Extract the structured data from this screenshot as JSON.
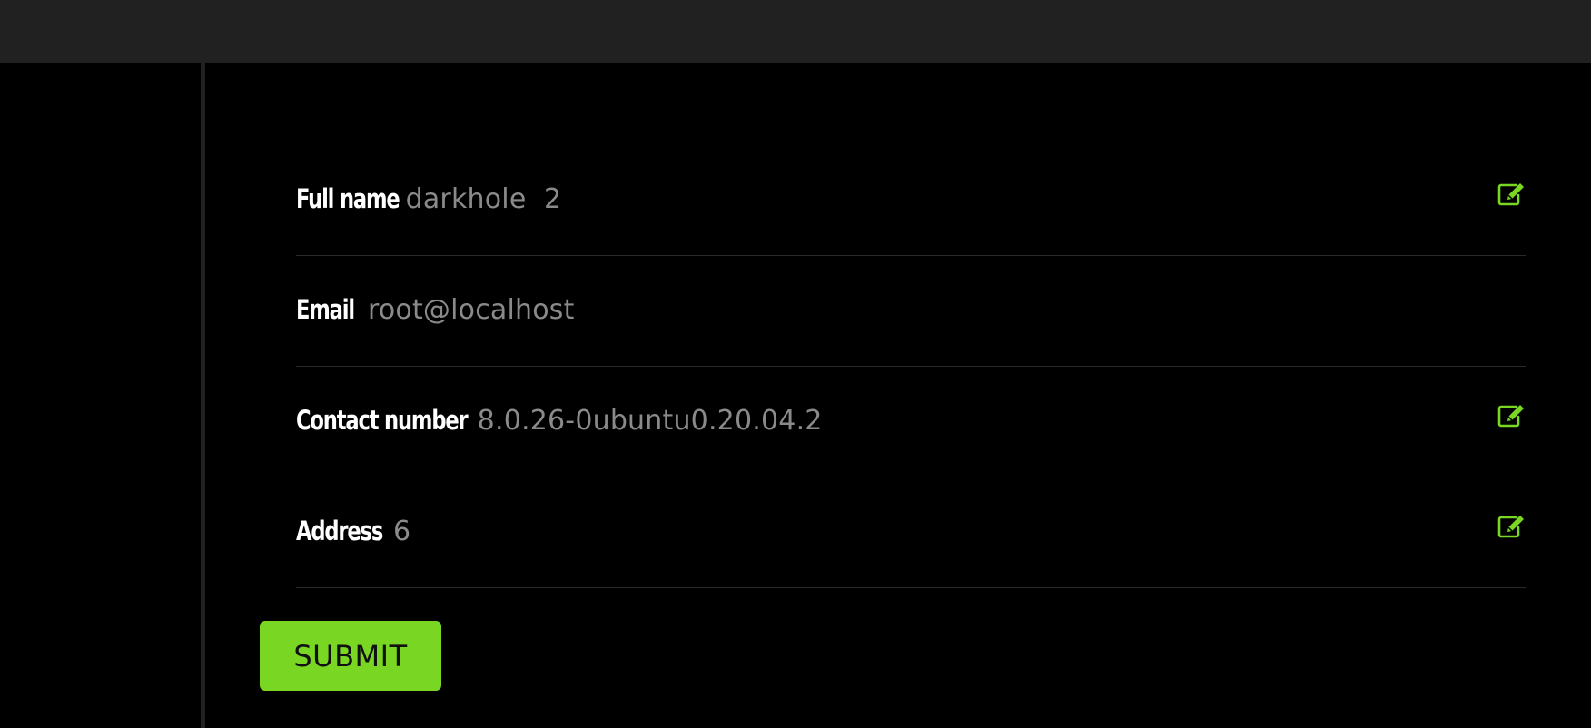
{
  "profile": {
    "fields": [
      {
        "label": "Full name",
        "value": "darkhole  2",
        "editable": true
      },
      {
        "label": "Email",
        "value": "root@localhost",
        "editable": false
      },
      {
        "label": "Contact number",
        "value": "8.0.26-0ubuntu0.20.04.2",
        "editable": true
      },
      {
        "label": "Address",
        "value": "6",
        "editable": true
      }
    ]
  },
  "form": {
    "submit_label": "SUBMIT"
  },
  "icons": {
    "edit": "edit-icon"
  },
  "colors": {
    "accent": "#79d623",
    "topbar": "#212121",
    "background": "#000000",
    "label": "#ffffff",
    "value": "#8a8a8a"
  }
}
